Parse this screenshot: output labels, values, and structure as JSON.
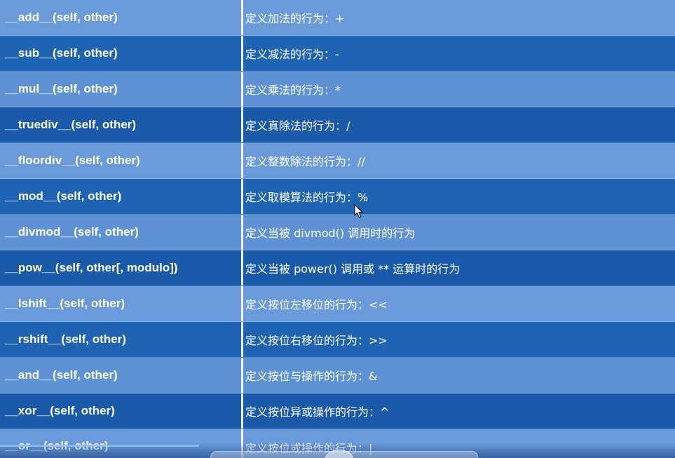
{
  "rows": [
    {
      "method": "__add__(self, other)",
      "desc": "定义加法的行为：+"
    },
    {
      "method": "__sub__(self, other)",
      "desc": "定义减法的行为：-"
    },
    {
      "method": "__mul__(self, other)",
      "desc": "定义乘法的行为：*"
    },
    {
      "method": "__truediv__(self, other)",
      "desc": "定义真除法的行为：/"
    },
    {
      "method": "__floordiv__(self, other)",
      "desc": "定义整数除法的行为：//"
    },
    {
      "method": "__mod__(self, other)",
      "desc": "定义取模算法的行为：%"
    },
    {
      "method": "__divmod__(self, other)",
      "desc": "定义当被 divmod() 调用时的行为"
    },
    {
      "method": "__pow__(self, other[, modulo])",
      "desc": "定义当被 power() 调用或 ** 运算时的行为"
    },
    {
      "method": "__lshift__(self, other)",
      "desc": "定义按位左移位的行为：<<"
    },
    {
      "method": "__rshift__(self, other)",
      "desc": "定义按位右移位的行为：>>"
    },
    {
      "method": "__and__(self, other)",
      "desc": "定义按位与操作的行为：&"
    },
    {
      "method": "__xor__(self, other)",
      "desc": "定义按位异或操作的行为：^"
    },
    {
      "method": "__or__(self, other)",
      "desc": "定义按位或操作的行为：|"
    }
  ],
  "colors": {
    "row_light": "#6a9ada",
    "row_dark": "#1f63b3",
    "divider": "#f2f6fb",
    "text": "#ffffff"
  },
  "icons": {
    "cursor": "mouse-pointer-icon"
  }
}
